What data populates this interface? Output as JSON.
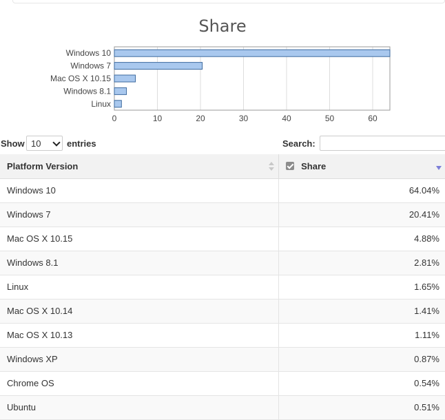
{
  "chart_data": {
    "type": "bar",
    "orientation": "horizontal",
    "title": "Share",
    "categories": [
      "Windows 10",
      "Windows 7",
      "Mac OS X 10.15",
      "Windows 8.1",
      "Linux"
    ],
    "values": [
      64.04,
      20.41,
      4.88,
      2.81,
      1.65
    ],
    "xlim": [
      0,
      64
    ],
    "xticks": [
      0,
      10,
      20,
      30,
      40,
      50,
      60
    ],
    "grid": true,
    "bar_color": "#a9c8ee",
    "bar_border_color": "#3d6a9e"
  },
  "controls": {
    "show_label": "Show",
    "entries_value": "10",
    "entries_label": "entries",
    "search_label": "Search:",
    "search_value": ""
  },
  "table": {
    "headers": {
      "platform": "Platform Version",
      "share": "Share"
    },
    "sort": {
      "column": "share",
      "direction": "desc"
    },
    "rows": [
      {
        "platform": "Windows 10",
        "share": "64.04%"
      },
      {
        "platform": "Windows 7",
        "share": "20.41%"
      },
      {
        "platform": "Mac OS X 10.15",
        "share": "4.88%"
      },
      {
        "platform": "Windows 8.1",
        "share": "2.81%"
      },
      {
        "platform": "Linux",
        "share": "1.65%"
      },
      {
        "platform": "Mac OS X 10.14",
        "share": "1.41%"
      },
      {
        "platform": "Mac OS X 10.13",
        "share": "1.11%"
      },
      {
        "platform": "Windows XP",
        "share": "0.87%"
      },
      {
        "platform": "Chrome OS",
        "share": "0.54%"
      },
      {
        "platform": "Ubuntu",
        "share": "0.51%"
      }
    ]
  },
  "colors": {
    "sort_active": "#7c7ed8",
    "header_bg": "#f2f2f2"
  }
}
